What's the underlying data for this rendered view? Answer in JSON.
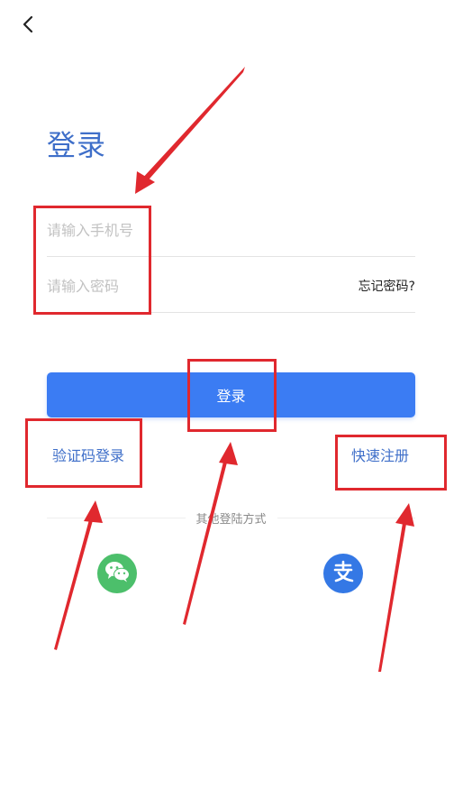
{
  "header": {
    "back_icon": "chevron-left-icon"
  },
  "page": {
    "title": "登录"
  },
  "form": {
    "phone_placeholder": "请输入手机号",
    "phone_value": "",
    "password_placeholder": "请输入密码",
    "password_value": "",
    "forgot_label": "忘记密码?",
    "login_label": "登录"
  },
  "links": {
    "sms_login": "验证码登录",
    "quick_register": "快速注册"
  },
  "other_login": {
    "label": "其他登陆方式",
    "options": [
      {
        "name": "wechat",
        "icon": "wechat-icon",
        "color": "#4cbf6b"
      },
      {
        "name": "alipay",
        "icon": "alipay-icon",
        "color": "#3478e5"
      }
    ]
  },
  "theme": {
    "accent": "#3b7cf3",
    "title_color": "#3f6fc9",
    "annotation_color": "#e0282e"
  }
}
